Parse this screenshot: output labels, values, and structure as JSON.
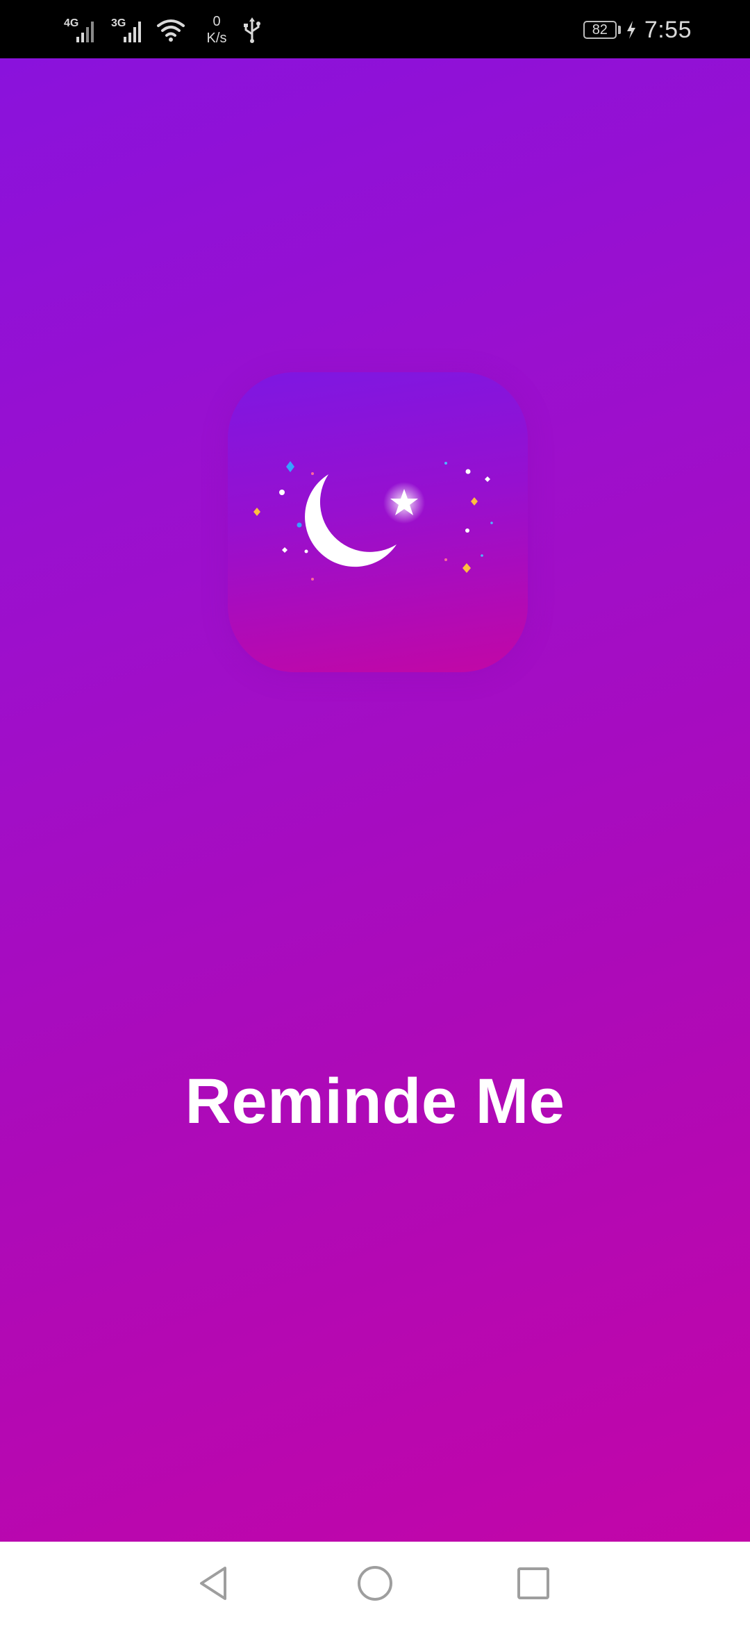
{
  "status_bar": {
    "signal_1_label": "4G",
    "signal_2_label": "3G",
    "net_speed_value": "0",
    "net_speed_unit": "K/s",
    "battery_level": "82",
    "time": "7:55",
    "icons": [
      "signal-4g-icon",
      "signal-3g-icon",
      "wifi-icon",
      "usb-icon",
      "battery-icon",
      "charging-icon"
    ]
  },
  "splash": {
    "app_icon": "moon-star-icon",
    "app_name": "Reminde Me",
    "colors": {
      "gradient_top": "#8a12dc",
      "gradient_bottom": "#c205a8",
      "title": "#ffffff"
    }
  },
  "nav_bar": {
    "icons": [
      "back-icon",
      "home-icon",
      "recents-icon"
    ]
  }
}
